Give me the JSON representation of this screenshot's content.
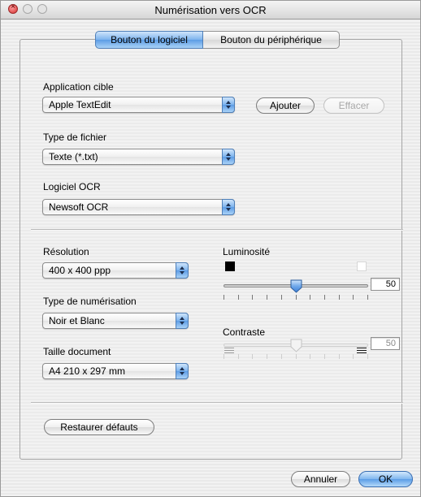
{
  "window": {
    "title": "Numérisation vers OCR"
  },
  "tabs": [
    {
      "label": "Bouton du logiciel",
      "active": true
    },
    {
      "label": "Bouton du périphérique",
      "active": false
    }
  ],
  "target_app": {
    "label": "Application cible",
    "value": "Apple TextEdit",
    "add_label": "Ajouter",
    "delete_label": "Effacer"
  },
  "file_type": {
    "label": "Type de fichier",
    "value": "Texte (*.txt)"
  },
  "ocr_software": {
    "label": "Logiciel OCR",
    "value": "Newsoft OCR"
  },
  "resolution": {
    "label": "Résolution",
    "value": "400 x 400 ppp"
  },
  "scan_type": {
    "label": "Type de numérisation",
    "value": "Noir et Blanc"
  },
  "document_size": {
    "label": "Taille document",
    "value": "A4 210 x 297 mm"
  },
  "brightness": {
    "label": "Luminosité",
    "value": "50",
    "min": 0,
    "max": 100,
    "enabled": true,
    "low_icon": "black-square-icon",
    "high_icon": "white-square-icon"
  },
  "contrast": {
    "label": "Contraste",
    "value": "50",
    "min": 0,
    "max": 100,
    "enabled": false,
    "low_icon": "low-contrast-lines-icon",
    "high_icon": "high-contrast-lines-icon"
  },
  "restore_defaults_label": "Restaurer défauts",
  "footer": {
    "cancel_label": "Annuler",
    "ok_label": "OK"
  },
  "colors": {
    "accent": "#5c9ce5",
    "disabled_text": "#a8a8a8",
    "close_light": "#d33030"
  }
}
